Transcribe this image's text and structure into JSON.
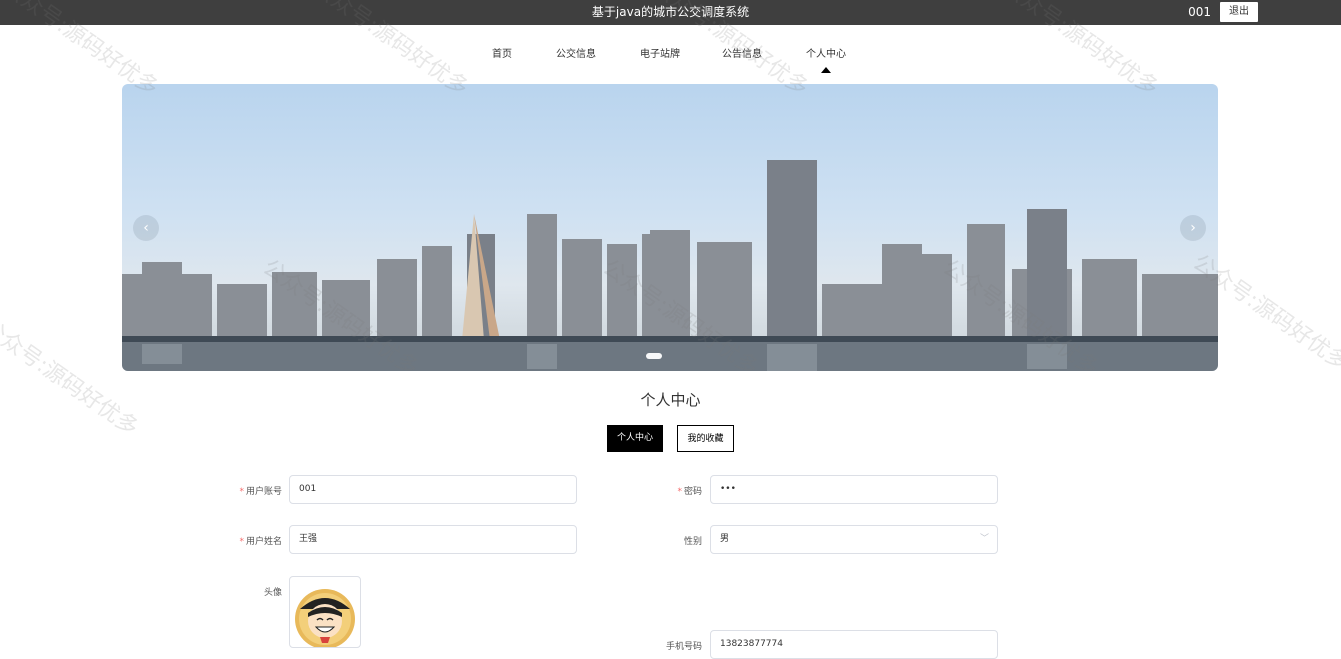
{
  "header": {
    "title": "基于java的城市公交调度系统",
    "username": "001",
    "logout_label": "退出"
  },
  "nav": {
    "items": [
      "首页",
      "公交信息",
      "电子站牌",
      "公告信息",
      "个人中心"
    ],
    "active_index": 4
  },
  "carousel": {
    "prev_icon": "‹",
    "next_icon": "›",
    "active_slide": 0
  },
  "section": {
    "title": "个人中心",
    "tabs": [
      "个人中心",
      "我的收藏"
    ]
  },
  "form": {
    "account_label": "用户账号",
    "account_value": "001",
    "password_label": "密码",
    "password_value": "•••",
    "name_label": "用户姓名",
    "name_value": "王强",
    "gender_label": "性别",
    "gender_value": "男",
    "avatar_label": "头像",
    "phone_label": "手机号码",
    "phone_value": "13823877774"
  },
  "watermark": {
    "text": "公众号:源码好优多"
  },
  "colors": {
    "topbar": "#3f3f3f",
    "required": "#f56c6c",
    "primary_button": "#000000"
  }
}
